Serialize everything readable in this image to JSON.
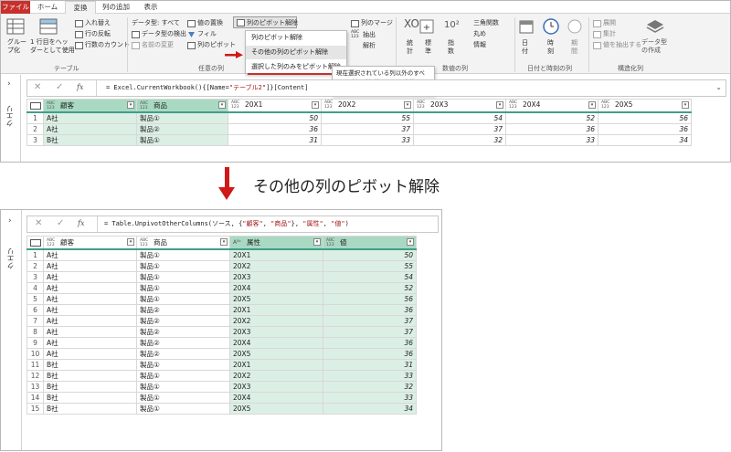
{
  "tabs": [
    "ファイル",
    "ホーム",
    "変換",
    "列の追加",
    "表示"
  ],
  "ribbon": {
    "group_table": {
      "grouping": "グルー\nプ化",
      "first_row": "1 行目をヘッ\nダーとして使用",
      "transpose": "入れ替え",
      "reverse_rows": "行の反転",
      "count_rows": "行数のカウント",
      "label": "テーブル"
    },
    "group_anycol": {
      "data_type": "データ型: すべて",
      "detect_type": "データ型の検出",
      "rename": "名前の変更",
      "replace_values": "値の置換",
      "fill": "フィル",
      "pivot": "列のピボット",
      "unpivot": "列のピボット解除",
      "label": "任意の列"
    },
    "group_text": {
      "merge": "列のマージ",
      "extract": "抽出",
      "parse": "解析"
    },
    "group_number": {
      "stats": "統\n計",
      "standard": "標\n準",
      "sci": "指\n数",
      "trig": "三角関数",
      "round": "丸め",
      "info": "情報",
      "label": "数値の列",
      "sigma": "XO",
      "ten": "10²"
    },
    "group_datetime": {
      "date": "日\n付",
      "time": "時\n刻",
      "duration": "期\n間",
      "label": "日付と時刻の列"
    },
    "group_struct": {
      "expand": "展開",
      "aggregate": "集計",
      "extract_values": "値を抽出する",
      "datatype_create": "データ型\nの作成",
      "label": "構造化列"
    }
  },
  "menu": {
    "items": [
      "列のピボット解除",
      "その他の列のピボット解除",
      "選択した列のみをピボット解除"
    ]
  },
  "tooltip": "現在選択されている列以外のすべての列を属性/値のペアに変換します。",
  "formula1": {
    "prefix": "= Excel.CurrentWorkbook(){[Name=",
    "str": "\"テーブル2\"",
    "suffix": "]}[Content]"
  },
  "query_label": "クエリ",
  "table1": {
    "columns": [
      "顧客",
      "商品",
      "20X1",
      "20X2",
      "20X3",
      "20X4",
      "20X5"
    ],
    "rows": [
      [
        "1",
        "A社",
        "製品①",
        "50",
        "55",
        "54",
        "52",
        "56"
      ],
      [
        "2",
        "A社",
        "製品②",
        "36",
        "37",
        "37",
        "36",
        "36"
      ],
      [
        "3",
        "B社",
        "製品①",
        "31",
        "33",
        "32",
        "33",
        "34"
      ]
    ]
  },
  "caption": "その他の列のピボット解除",
  "formula2": {
    "prefix": "= Table.UnpivotOtherColumns(ソース, {",
    "s1": "\"顧客\"",
    "c1": ", ",
    "s2": "\"商品\"",
    "c2": "}, ",
    "s3": "\"属性\"",
    "c3": ", ",
    "s4": "\"値\"",
    "suffix": ")"
  },
  "table2": {
    "columns": [
      "顧客",
      "商品",
      "属性",
      "値"
    ],
    "rows": [
      [
        "1",
        "A社",
        "製品①",
        "20X1",
        "50"
      ],
      [
        "2",
        "A社",
        "製品①",
        "20X2",
        "55"
      ],
      [
        "3",
        "A社",
        "製品①",
        "20X3",
        "54"
      ],
      [
        "4",
        "A社",
        "製品①",
        "20X4",
        "52"
      ],
      [
        "5",
        "A社",
        "製品①",
        "20X5",
        "56"
      ],
      [
        "6",
        "A社",
        "製品②",
        "20X1",
        "36"
      ],
      [
        "7",
        "A社",
        "製品②",
        "20X2",
        "37"
      ],
      [
        "8",
        "A社",
        "製品②",
        "20X3",
        "37"
      ],
      [
        "9",
        "A社",
        "製品②",
        "20X4",
        "36"
      ],
      [
        "10",
        "A社",
        "製品②",
        "20X5",
        "36"
      ],
      [
        "11",
        "B社",
        "製品①",
        "20X1",
        "31"
      ],
      [
        "12",
        "B社",
        "製品①",
        "20X2",
        "33"
      ],
      [
        "13",
        "B社",
        "製品①",
        "20X3",
        "32"
      ],
      [
        "14",
        "B社",
        "製品①",
        "20X4",
        "33"
      ],
      [
        "15",
        "B社",
        "製品①",
        "20X5",
        "34"
      ]
    ]
  },
  "type_tags": {
    "any": "ABC\n123",
    "text": "Aᴮᶜ"
  },
  "colors": {
    "accent_green": "#3f9f8a",
    "selected_col": "#dcefe4",
    "file_tab": "#c8302c",
    "arrow_red": "#d01818"
  }
}
